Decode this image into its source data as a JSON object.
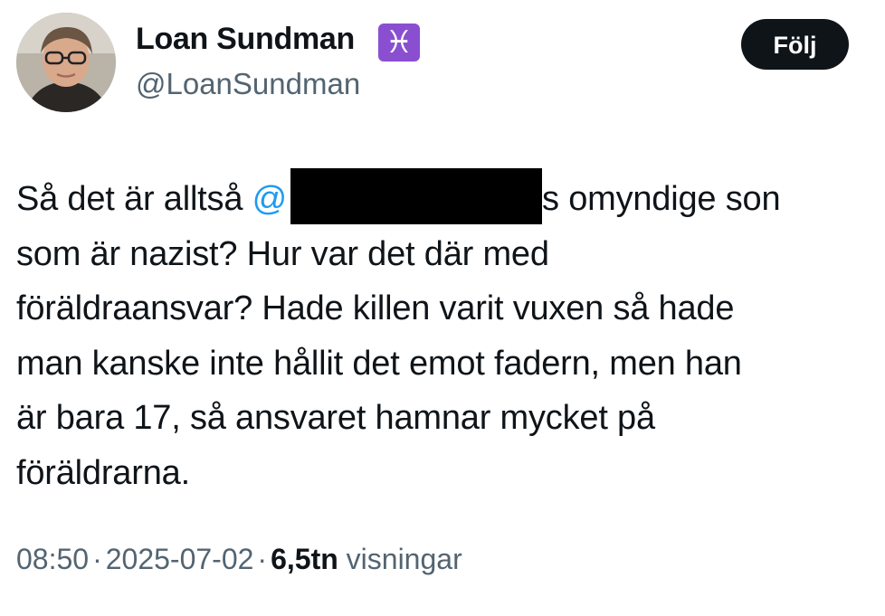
{
  "author": {
    "display_name": "Loan Sundman",
    "badge_symbol": "♓",
    "badge_icon": "pisces-icon",
    "handle": "@LoanSundman"
  },
  "actions": {
    "follow_label": "Följ"
  },
  "tweet": {
    "line1_before_mention": "Så det är alltså ",
    "mention_prefix": "@",
    "line1_after_redaction": "s omyndige son",
    "line2": "som är nazist? Hur var det där med",
    "line3": "föräldraansvar? Hade killen varit vuxen så hade",
    "line4": "man kanske inte hållit det emot fadern, men han",
    "line5": "är bara 17, så ansvaret hamnar mycket på",
    "line6": "föräldrarna."
  },
  "meta": {
    "time": "08:50",
    "separator": "·",
    "date": "2025-07-02",
    "views_count": "6,5tn",
    "views_label": "visningar"
  },
  "colors": {
    "text": "#0f1419",
    "secondary": "#536471",
    "mention": "#1d9bf0",
    "badge": "#8a4fd1",
    "button_bg": "#0f1419"
  }
}
